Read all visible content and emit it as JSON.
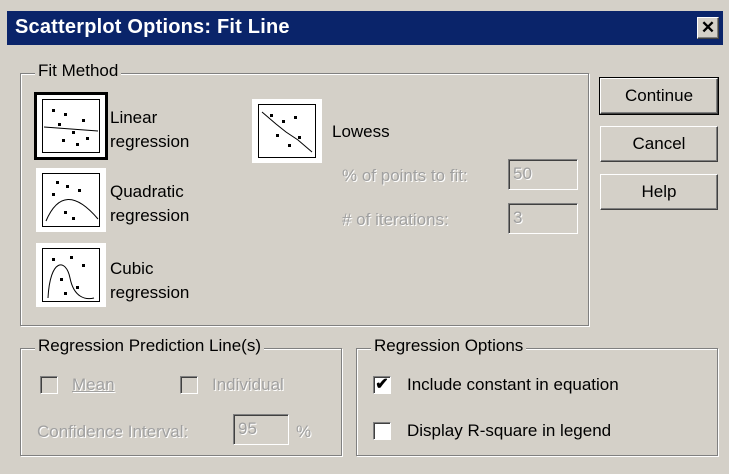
{
  "window": {
    "title": "Scatterplot Options: Fit Line",
    "close_glyph": "✕"
  },
  "fit_method": {
    "legend": "Fit Method",
    "linear": {
      "line1": "Linear",
      "line2": "regression",
      "icon": "linear-fit-icon",
      "selected": true
    },
    "quadratic": {
      "line1": "Quadratic",
      "line2": "regression",
      "icon": "quadratic-fit-icon"
    },
    "cubic": {
      "line1": "Cubic",
      "line2": "regression",
      "icon": "cubic-fit-icon"
    },
    "lowess": {
      "label": "Lowess",
      "icon": "lowess-fit-icon",
      "points_label": "% of points to fit:",
      "points_value": "50",
      "iterations_label": "# of iterations:",
      "iterations_value": "3"
    }
  },
  "buttons": {
    "continue": "Continue",
    "cancel": "Cancel",
    "help": "Help"
  },
  "prediction": {
    "legend": "Regression Prediction Line(s)",
    "mean": "Mean",
    "individual": "Individual",
    "ci_label": "Confidence Interval:",
    "ci_value": "95",
    "ci_unit": "%"
  },
  "options": {
    "legend": "Regression Options",
    "include_constant": "Include constant in equation",
    "include_constant_checked": true,
    "display_rsquare": "Display R-square in legend",
    "display_rsquare_checked": false
  },
  "colors": {
    "titlebar": "#0a246a",
    "face": "#d4d0c8"
  }
}
